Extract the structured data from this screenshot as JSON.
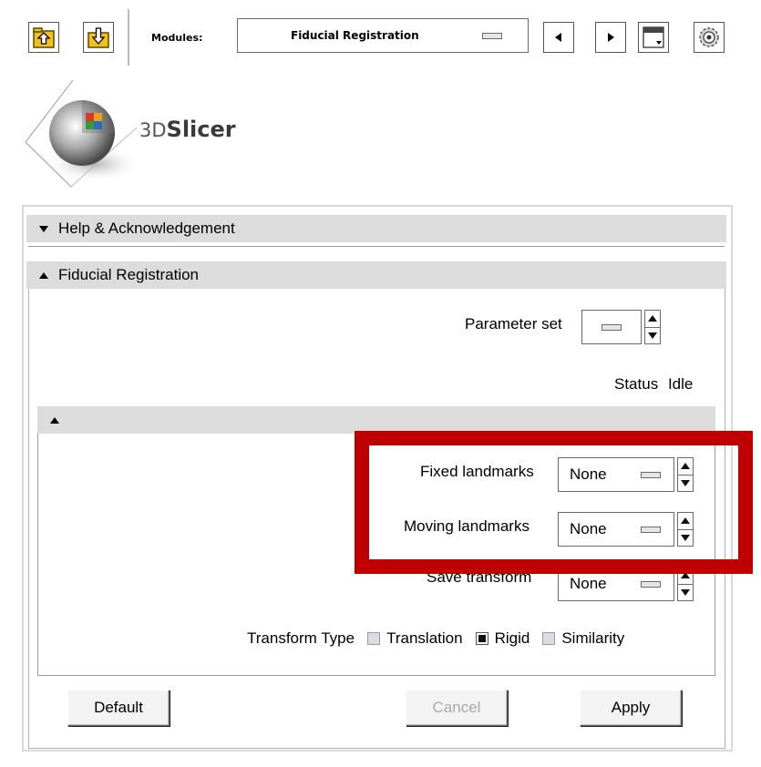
{
  "toolbar": {
    "modules_label": "Modules:",
    "module_selected": "Fiducial Registration"
  },
  "logo": {
    "text_3d": "3D",
    "text_slicer": "Slicer"
  },
  "help_section": {
    "title": "Help & Acknowledgement"
  },
  "main_section": {
    "title": "Fiducial Registration"
  },
  "parameter_set": {
    "label": "Parameter set"
  },
  "status": {
    "label": "Status",
    "value": "Idle"
  },
  "fields": {
    "fixed": {
      "label": "Fixed landmarks",
      "value": "None"
    },
    "moving": {
      "label": "Moving landmarks",
      "value": "None"
    },
    "save": {
      "label": "Save transform",
      "value": "None"
    }
  },
  "transform_type": {
    "label": "Transform Type",
    "options": [
      {
        "label": "Translation",
        "checked": false
      },
      {
        "label": "Rigid",
        "checked": true
      },
      {
        "label": "Similarity",
        "checked": false
      }
    ]
  },
  "buttons": {
    "default": "Default",
    "cancel": "Cancel",
    "apply": "Apply"
  },
  "highlight": {
    "color": "#c00000"
  }
}
